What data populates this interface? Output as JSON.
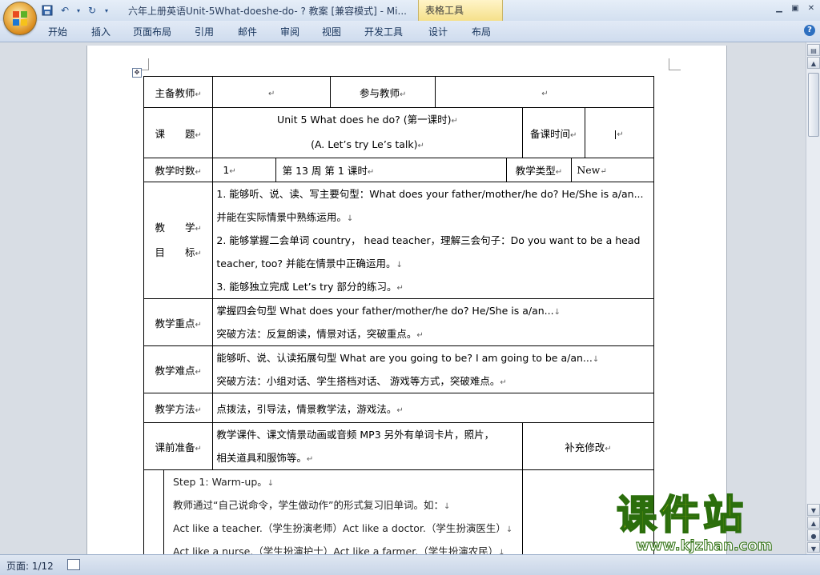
{
  "window": {
    "title": "六年上册英语Unit-5What-doeshe-do- ? 教案 [兼容模式] - Mi...",
    "context_tab_group": "表格工具",
    "controls": [
      "minimize",
      "restore",
      "close"
    ]
  },
  "ribbon": {
    "tabs": [
      "开始",
      "插入",
      "页面布局",
      "引用",
      "邮件",
      "审阅",
      "视图",
      "开发工具",
      "设计",
      "布局"
    ]
  },
  "status": {
    "page": "页面: 1/12"
  },
  "table": {
    "r1": {
      "lead": "主备教师",
      "lead_val": "",
      "part": "参与教师",
      "part_val": ""
    },
    "r2": {
      "label": "课　　题",
      "title_line1": "Unit 5   What does he do?   (第一课时)",
      "title_line2": "(A. Let’s try Le’s talk)",
      "prep_time": "备课时间"
    },
    "r3": {
      "hours_label": "教学时数",
      "hours": "1",
      "week": "第   13  周       第   1 课时",
      "type_label": "教学类型",
      "type": "New"
    },
    "goals": {
      "label_top": "教　　学",
      "label_bottom": "目　　标",
      "lines": [
        "1. 能够听、说、读、写主要句型：What does your father/mother/he do? He/She is a/an...",
        "并能在实际情景中熟练运用。",
        "2. 能够掌握二会单词 country， head teacher，理解三会句子：Do you want to be a head",
        "teacher, too? 并能在情景中正确运用。",
        "3. 能够独立完成 Let’s try 部分的练习。"
      ]
    },
    "key": {
      "label": "教学重点",
      "lines": [
        "掌握四会句型 What does your father/mother/he do? He/She is a/an...",
        "突破方法：反复朗读，情景对话，突破重点。"
      ]
    },
    "difficult": {
      "label": "教学难点",
      "lines": [
        "能够听、说、认读拓展句型 What are you going to be? I am going to be a/an...",
        "突破方法：小组对话、学生搭档对话、 游戏等方式，突破难点。"
      ]
    },
    "method": {
      "label": "教学方法",
      "text": "点拨法，引导法，情景教学法，游戏法。"
    },
    "prep": {
      "label": "课前准备",
      "lines": [
        "教学课件、课文情景动画或音频 MP3 另外有单词卡片，照片，",
        "相关道具和服饰等。"
      ],
      "supplement": "补充修改"
    },
    "steps": [
      "Step 1: Warm-up。",
      "教师通过“自己说命令，学生做动作”的形式复习旧单词。如：",
      "Act like a teacher.（学生扮演老师）Act like a doctor.（学生扮演医生）",
      "Act like a nurse.（学生扮演护士）Act like a farmer.（学生扮演农民）"
    ]
  },
  "watermark": {
    "big": "课件站",
    "small": "www.kjzhan.com"
  },
  "marks": {
    "cell": "↵",
    "para": "↓"
  }
}
